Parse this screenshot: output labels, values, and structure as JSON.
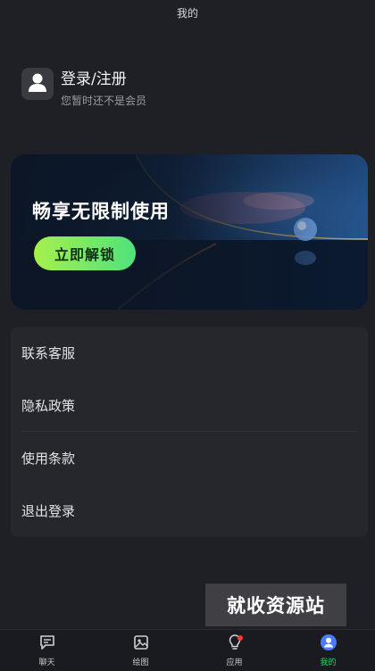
{
  "header": {
    "title": "我的"
  },
  "profile": {
    "login_label": "登录/注册",
    "subtitle": "您暂时还不是会员",
    "avatar_icon": "user-icon"
  },
  "banner": {
    "title": "畅享无限制使用",
    "button_label": "立即解锁"
  },
  "menu": {
    "items": [
      {
        "label": "联系客服"
      },
      {
        "label": "隐私政策"
      },
      {
        "label": "使用条款"
      },
      {
        "label": "退出登录"
      }
    ]
  },
  "watermark": "就收资源站",
  "tabbar": {
    "tabs": [
      {
        "label": "聊天",
        "icon": "chat-icon"
      },
      {
        "label": "绘图",
        "icon": "image-icon"
      },
      {
        "label": "应用",
        "icon": "lightbulb-icon",
        "badge": true
      },
      {
        "label": "我的",
        "icon": "profile-icon",
        "active": true
      }
    ],
    "active_color": "#2bd56b"
  }
}
